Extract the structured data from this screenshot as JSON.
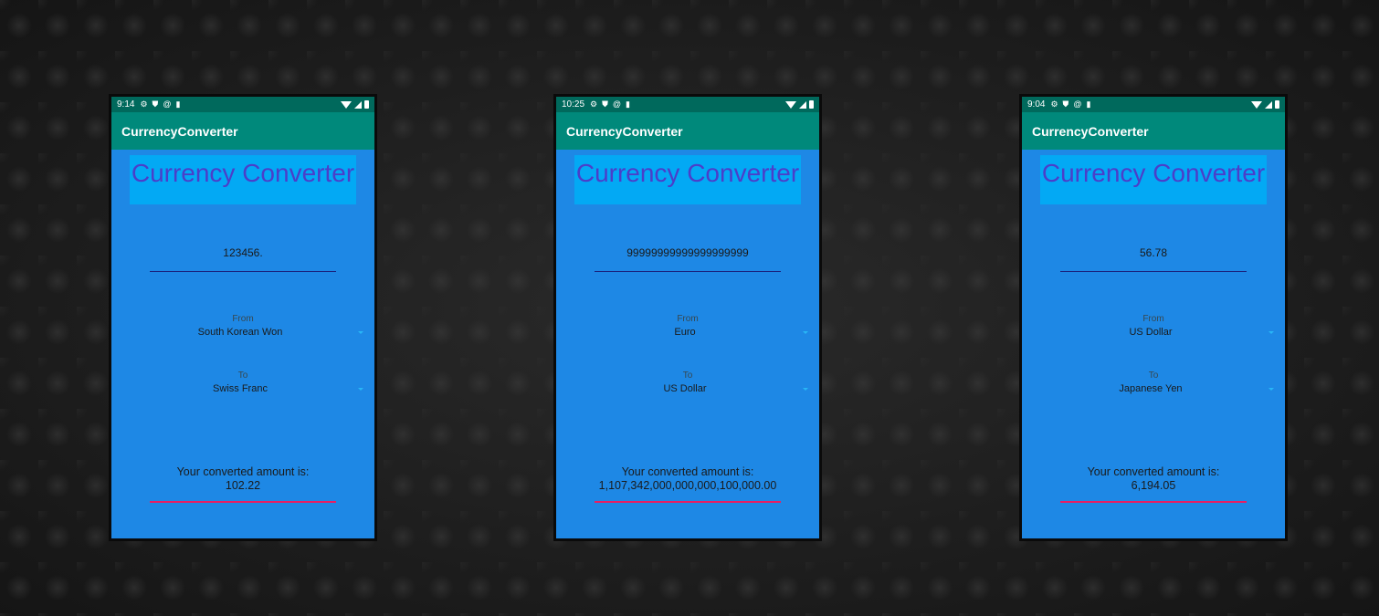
{
  "app": {
    "title": "CurrencyConverter",
    "heading": "Currency Converter",
    "from_label": "From",
    "to_label": "To",
    "result_caption": "Your converted amount is:",
    "status_icons": [
      "gear-icon",
      "shield-icon",
      "at-icon",
      "sd-card-icon",
      "wifi-icon",
      "signal-icon",
      "battery-icon"
    ]
  },
  "screens": [
    {
      "time": "9:14",
      "amount": "123456.",
      "from": "South Korean Won",
      "to": "Swiss Franc",
      "result": "102.22"
    },
    {
      "time": "10:25",
      "amount": "99999999999999999999",
      "from": "Euro",
      "to": "US Dollar",
      "result": "1,107,342,000,000,000,100,000.00"
    },
    {
      "time": "9:04",
      "amount": "56.78",
      "from": "US Dollar",
      "to": "Japanese Yen",
      "result": "6,194.05"
    }
  ],
  "colors": {
    "status_bar": "#00695c",
    "app_bar": "#00897b",
    "screen_bg": "#1e88e5",
    "heading_bg": "#03a9f4",
    "heading_text": "#4b3ec9",
    "result_underline": "#e91e63"
  }
}
